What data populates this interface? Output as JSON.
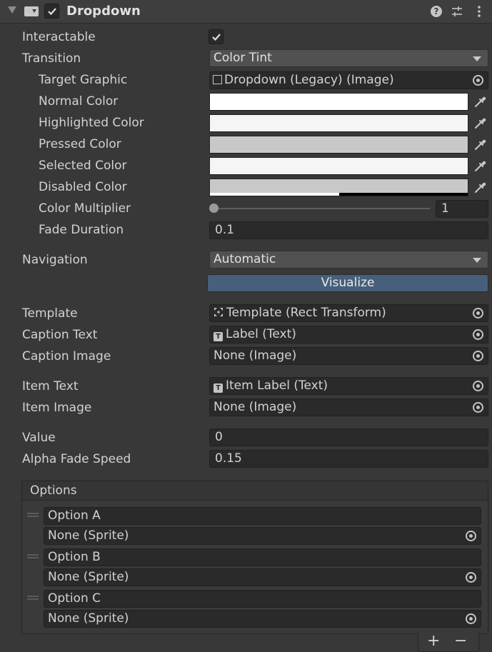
{
  "component": {
    "title": "Dropdown",
    "enabled": true
  },
  "header_icons": [
    "help-icon",
    "presets-icon",
    "more-icon"
  ],
  "interactable": {
    "label": "Interactable",
    "checked": true
  },
  "transition": {
    "label": "Transition",
    "value": "Color Tint"
  },
  "target_graphic": {
    "label": "Target Graphic",
    "value": "Dropdown (Legacy) (Image)"
  },
  "colors": [
    {
      "label": "Normal Color",
      "color": "#ffffff"
    },
    {
      "label": "Highlighted Color",
      "color": "#f5f5f5"
    },
    {
      "label": "Pressed Color",
      "color": "#c8c8c8"
    },
    {
      "label": "Selected Color",
      "color": "#f5f5f5"
    },
    {
      "label": "Disabled Color",
      "color": "#c8c8c8",
      "alpha": 0.5
    }
  ],
  "color_multiplier": {
    "label": "Color Multiplier",
    "value": "1",
    "fraction": 0
  },
  "fade_duration": {
    "label": "Fade Duration",
    "value": "0.1"
  },
  "navigation": {
    "label": "Navigation",
    "value": "Automatic",
    "button": "Visualize"
  },
  "template": {
    "label": "Template",
    "value": "Template (Rect Transform)"
  },
  "caption_text": {
    "label": "Caption Text",
    "value": "Label (Text)"
  },
  "caption_image": {
    "label": "Caption Image",
    "value": "None (Image)"
  },
  "item_text": {
    "label": "Item Text",
    "value": "Item Label (Text)"
  },
  "item_image": {
    "label": "Item Image",
    "value": "None (Image)"
  },
  "value": {
    "label": "Value",
    "value": "0"
  },
  "alpha_fade_speed": {
    "label": "Alpha Fade Speed",
    "value": "0.15"
  },
  "options": {
    "title": "Options",
    "items": [
      {
        "text": "Option A",
        "sprite": "None (Sprite)"
      },
      {
        "text": "Option B",
        "sprite": "None (Sprite)"
      },
      {
        "text": "Option C",
        "sprite": "None (Sprite)"
      }
    ],
    "add_label": "+",
    "remove_label": "−"
  },
  "text_badge": "T"
}
